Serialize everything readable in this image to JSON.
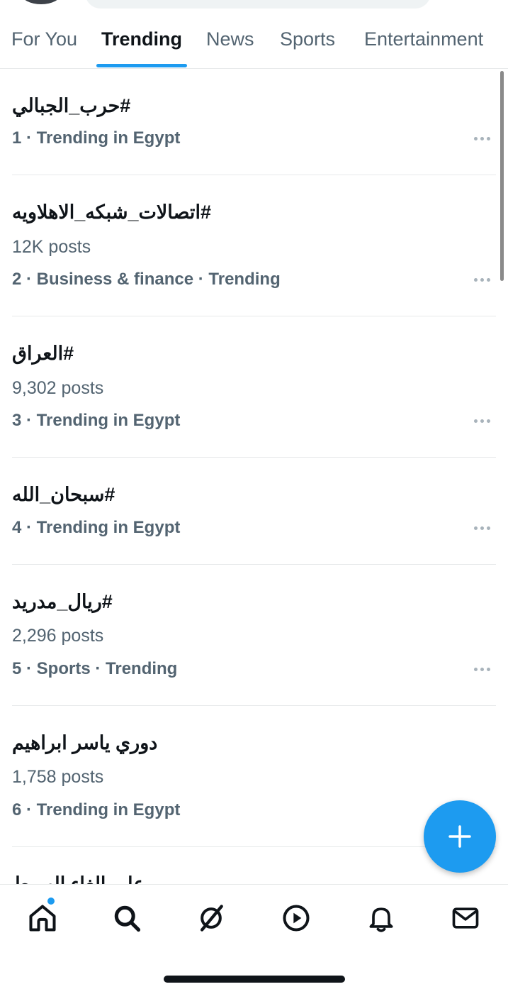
{
  "tabs": [
    {
      "label": "For You",
      "active": false
    },
    {
      "label": "Trending",
      "active": true
    },
    {
      "label": "News",
      "active": false
    },
    {
      "label": "Sports",
      "active": false
    },
    {
      "label": "Entertainment",
      "active": false
    }
  ],
  "trends": [
    {
      "name": "#حرب_الجبالي",
      "posts": "",
      "meta": "1 · Trending in Egypt"
    },
    {
      "name": "#اتصالات_شبكه_الاهلاويه",
      "posts": "12K posts",
      "meta": "2 · Business & finance · Trending"
    },
    {
      "name": "#العراق",
      "posts": "9,302 posts",
      "meta": "3 · Trending in Egypt"
    },
    {
      "name": "#سبحان_الله",
      "posts": "",
      "meta": "4 · Trending in Egypt"
    },
    {
      "name": "#ريال_مدريد",
      "posts": "2,296 posts",
      "meta": "5 · Sports · Trending"
    },
    {
      "name": "دوري ياسر ابراهيم",
      "posts": "1,758 posts",
      "meta": "6 · Trending in Egypt"
    },
    {
      "name": "علي الغاء الهبوط",
      "posts": "",
      "meta": ""
    }
  ],
  "nav": [
    {
      "icon": "home-icon",
      "has_notification": true
    },
    {
      "icon": "search-icon",
      "has_notification": false
    },
    {
      "icon": "grok-icon",
      "has_notification": false
    },
    {
      "icon": "video-icon",
      "has_notification": false
    },
    {
      "icon": "notifications-icon",
      "has_notification": false
    },
    {
      "icon": "messages-icon",
      "has_notification": false
    }
  ],
  "fab": {
    "icon": "plus-icon"
  },
  "colors": {
    "accent": "#1d9bf0",
    "text_primary": "#0f1419",
    "text_secondary": "#536471",
    "divider": "#e7e9ea"
  }
}
